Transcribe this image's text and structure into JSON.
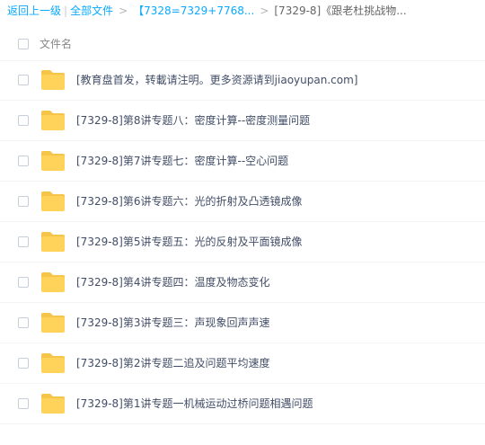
{
  "breadcrumb": {
    "back_label": "返回上一级",
    "separator": "|",
    "all_files_label": "全部文件",
    "arrow": ">",
    "parent_folder": "【7328=7329+7768...",
    "current_folder": "[7329-8]《跟老杜挑战物..."
  },
  "list_header": {
    "column_name": "文件名"
  },
  "colors": {
    "link": "#09aaff",
    "folder": "#ffd35a",
    "folder_back": "#f7c44a",
    "text": "#424e67"
  },
  "files": [
    {
      "name": "[教育盘首发，转載请注明。更多资源请到jiaoyupan.com]",
      "icon": "folder-icon"
    },
    {
      "name": "[7329-8]第8讲专题八：密度计算--密度测量问题",
      "icon": "folder-icon"
    },
    {
      "name": "[7329-8]第7讲专题七：密度计算--空心问题",
      "icon": "folder-icon"
    },
    {
      "name": "[7329-8]第6讲专题六：光的折射及凸透镜成像",
      "icon": "folder-icon"
    },
    {
      "name": "[7329-8]第5讲专题五：光的反射及平面镜成像",
      "icon": "folder-icon"
    },
    {
      "name": "[7329-8]第4讲专题四：温度及物态变化",
      "icon": "folder-icon"
    },
    {
      "name": "[7329-8]第3讲专题三：声现象回声声速",
      "icon": "folder-icon"
    },
    {
      "name": "[7329-8]第2讲专题二追及问题平均速度",
      "icon": "folder-icon"
    },
    {
      "name": "[7329-8]第1讲专题一机械运动过桥问题相遇问题",
      "icon": "folder-icon"
    }
  ]
}
